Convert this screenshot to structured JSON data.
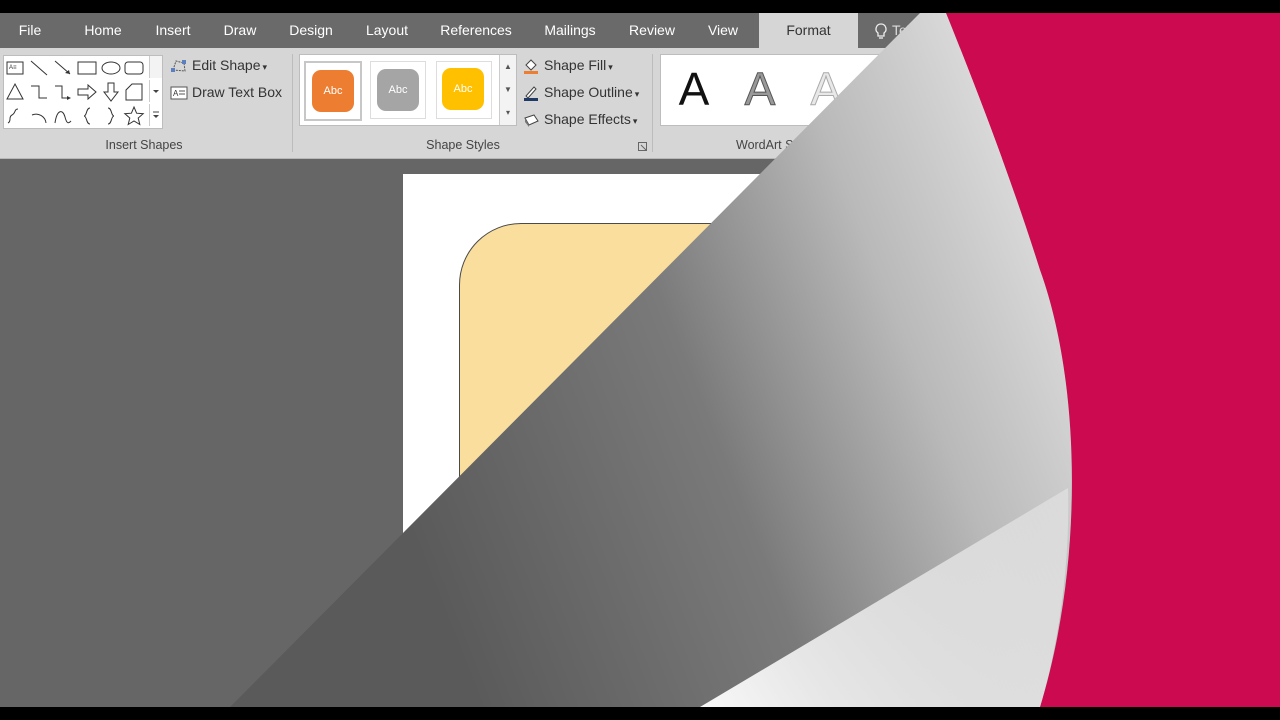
{
  "tabs": [
    "File",
    "Home",
    "Insert",
    "Draw",
    "Design",
    "Layout",
    "References",
    "Mailings",
    "Review",
    "View",
    "Format"
  ],
  "active_tab": "Format",
  "tell_me": "Tell m",
  "groups": {
    "insert_shapes": "Insert Shapes",
    "shape_styles": "Shape Styles",
    "wordart_styles": "WordArt Styl"
  },
  "commands": {
    "edit_shape": "Edit Shape",
    "draw_text_box": "Draw Text Box",
    "shape_fill": "Shape Fill",
    "shape_outline": "Shape Outline",
    "shape_effects": "Shape Effects"
  },
  "style_swatches": [
    {
      "label": "Abc",
      "color": "#ed7d31"
    },
    {
      "label": "Abc",
      "color": "#a5a5a5"
    },
    {
      "label": "Abc",
      "color": "#ffc000"
    }
  ],
  "wordart": [
    "A",
    "A",
    "A"
  ],
  "colors": {
    "ribbon": "#d6d6d6",
    "tabbar": "#6a6a6a",
    "canvas": "#666666",
    "shape_fill": "#f9de9d",
    "accent_red": "#cc0a50"
  }
}
